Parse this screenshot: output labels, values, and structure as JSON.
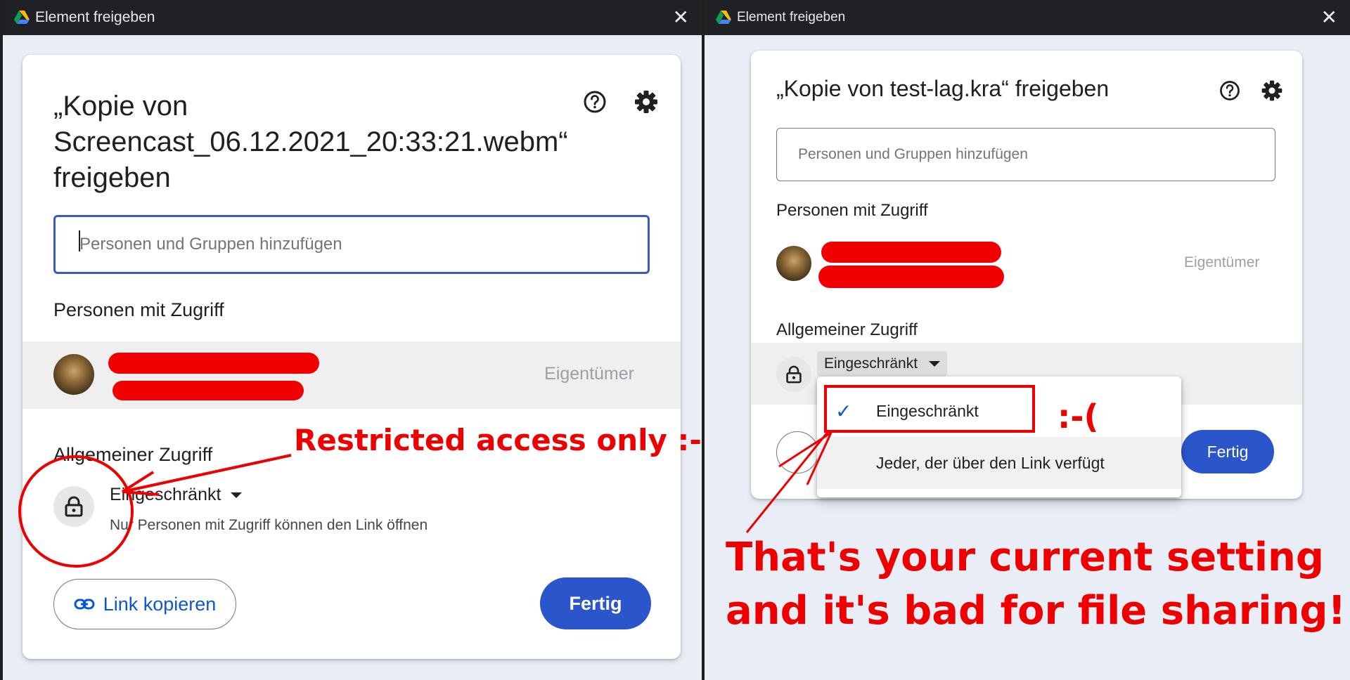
{
  "left_window": {
    "title": "Element freigeben",
    "close_glyph": "✕",
    "dialog": {
      "title_line1": "„Kopie von",
      "title_line2": "Screencast_06.12.2021_20:33:21.webm“",
      "title_line3": "freigeben",
      "search_placeholder": "Personen und Gruppen hinzufügen",
      "people_heading": "Personen mit Zugriff",
      "owner_role": "Eigentümer",
      "general_access_heading": "Allgemeiner Zugriff",
      "access_level": "Eingeschränkt",
      "access_description": "Nur Personen mit Zugriff können den Link öffnen",
      "copy_link_label": "Link kopieren",
      "done_label": "Fertig"
    },
    "annotation": "Restricted access only :-("
  },
  "right_window": {
    "title": "Element freigeben",
    "close_glyph": "✕",
    "dialog": {
      "title": "„Kopie von test-lag.kra“ freigeben",
      "search_placeholder": "Personen und Gruppen hinzufügen",
      "people_heading": "Personen mit Zugriff",
      "owner_role": "Eigentümer",
      "general_access_heading": "Allgemeiner Zugriff",
      "access_level": "Eingeschränkt",
      "done_label": "Fertig",
      "menu": {
        "selected_check": "✓",
        "options": [
          "Eingeschränkt",
          "Jeder, der über den Link verfügt"
        ]
      }
    },
    "annotation_sad": ":-(",
    "annotation_line1": "That's your current setting",
    "annotation_line2": "and it's bad for file sharing!"
  },
  "colors": {
    "accent_blue": "#2a55cb",
    "annotation_red": "#ee0000",
    "titlebar": "#202124"
  },
  "icons": [
    "google-drive-logo-icon",
    "close-icon",
    "help-icon",
    "settings-gear-icon",
    "lock-icon",
    "link-icon",
    "checkmark-icon",
    "dropdown-caret-icon"
  ]
}
